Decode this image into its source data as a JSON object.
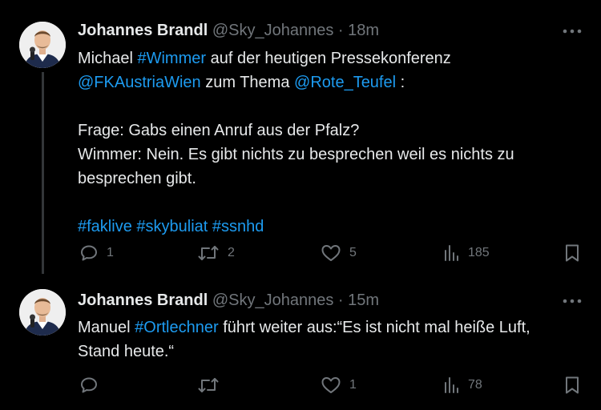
{
  "tweets": [
    {
      "author_name": "Johannes Brandl",
      "handle": "@Sky_Johannes",
      "separator": "·",
      "time": "18m",
      "text_lines": [
        [
          {
            "t": "Michael ",
            "link": false
          },
          {
            "t": "#Wimmer",
            "link": true
          },
          {
            "t": " auf der heutigen Pressekonferenz",
            "link": false
          }
        ],
        [
          {
            "t": "@FKAustriaWien",
            "link": true
          },
          {
            "t": " zum Thema ",
            "link": false
          },
          {
            "t": "@Rote_Teufel",
            "link": true
          },
          {
            "t": " :",
            "link": false
          }
        ],
        [],
        [
          {
            "t": "Frage: Gabs einen Anruf aus der Pfalz?",
            "link": false
          }
        ],
        [
          {
            "t": "Wimmer: Nein. Es gibt nichts zu besprechen weil es nichts zu",
            "link": false
          }
        ],
        [
          {
            "t": "besprechen gibt.",
            "link": false
          }
        ],
        [],
        [
          {
            "t": "#faklive",
            "link": true
          },
          {
            "t": " ",
            "link": false
          },
          {
            "t": "#skybuliat",
            "link": true
          },
          {
            "t": " ",
            "link": false
          },
          {
            "t": "#ssnhd",
            "link": true
          }
        ]
      ],
      "counts": {
        "reply": "1",
        "retweet": "2",
        "like": "5",
        "views": "185"
      }
    },
    {
      "author_name": "Johannes Brandl",
      "handle": "@Sky_Johannes",
      "separator": "·",
      "time": "15m",
      "text_lines": [
        [
          {
            "t": "Manuel ",
            "link": false
          },
          {
            "t": "#Ortlechner",
            "link": true
          },
          {
            "t": " führt weiter aus:“Es ist nicht mal heiße Luft,",
            "link": false
          }
        ],
        [
          {
            "t": "Stand heute.“",
            "link": false
          }
        ]
      ],
      "counts": {
        "reply": "",
        "retweet": "",
        "like": "1",
        "views": "78"
      }
    }
  ],
  "icons": {
    "more": "more-horizontal-icon",
    "reply": "reply-icon",
    "retweet": "retweet-icon",
    "like": "like-heart-icon",
    "views": "views-analytics-icon",
    "bookmark": "bookmark-icon"
  },
  "colors": {
    "background": "#000000",
    "text": "#e7e9ea",
    "muted": "#71767b",
    "link": "#1d9bf0",
    "thread_line": "#333639"
  }
}
